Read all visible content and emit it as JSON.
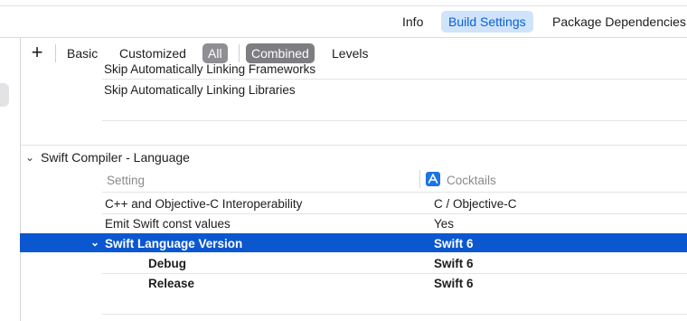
{
  "tabs": [
    {
      "label": "Info"
    },
    {
      "label": "Build Settings"
    },
    {
      "label": "Package Dependencies"
    }
  ],
  "filter": {
    "add_symbol": "+",
    "basic": "Basic",
    "customized": "Customized",
    "all": "All",
    "combined": "Combined",
    "levels": "Levels"
  },
  "rows_above": [
    {
      "label": "Skip Automatically Linking Frameworks"
    },
    {
      "label": "Skip Automatically Linking Libraries"
    }
  ],
  "section": {
    "title": "Swift Compiler - Language",
    "setting_header": "Setting",
    "target_header": "Cocktails",
    "rows": [
      {
        "label": "C++ and Objective-C Interoperability",
        "value": "C / Objective-C"
      },
      {
        "label": "Emit Swift const values",
        "value": "Yes"
      },
      {
        "label": "Swift Language Version",
        "value": "Swift 6"
      },
      {
        "label": "Debug",
        "value": "Swift 6"
      },
      {
        "label": "Release",
        "value": "Swift 6"
      }
    ]
  },
  "colors": {
    "selection": "#0b57d0",
    "tab_selected_bg": "#cfe4fb",
    "tab_selected_fg": "#0a5ed7",
    "pill": "#8e8e93"
  }
}
